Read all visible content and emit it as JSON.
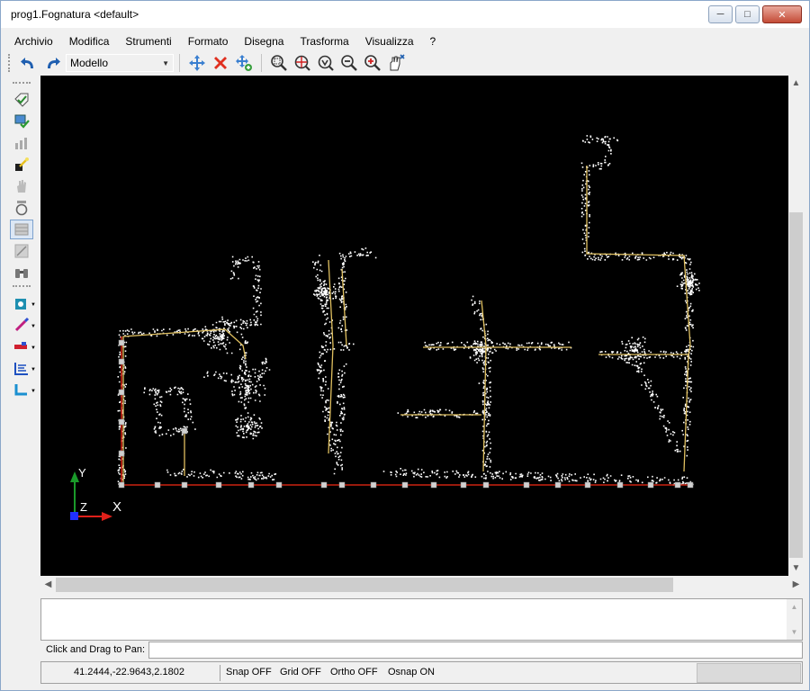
{
  "window": {
    "title": "prog1.Fognatura <default>",
    "controls": {
      "minimize": "─",
      "maximize": "□",
      "close": "✕"
    }
  },
  "menu": [
    "Archivio",
    "Modifica",
    "Strumenti",
    "Formato",
    "Disegna",
    "Trasforma",
    "Visualizza",
    "?"
  ],
  "toolbar": {
    "space_combo": "Modello",
    "buttons": [
      "undo-icon",
      "redo-icon",
      "move-icon",
      "delete-icon",
      "copy-move-icon",
      "zoom-window-icon",
      "zoom-center-icon",
      "zoom-extents-icon",
      "zoom-out-icon",
      "zoom-in-icon",
      "pan-icon"
    ]
  },
  "left_toolbar": [
    "properties-icon",
    "check-icon",
    "chart-icon",
    "wand-icon",
    "hand-icon",
    "manhole-icon",
    "grid-select-icon",
    "tile-icon",
    "binoculars-icon",
    "cam-icon",
    "brush-icon",
    "pipe-icon",
    "profile-icon",
    "connection-icon"
  ],
  "axes": {
    "y_label": "Y",
    "z_label": "Z",
    "x_label": "X"
  },
  "colors": {
    "canvas_bg": "#000000",
    "points": "#ffffff",
    "pipe_red": "#cc2211",
    "pipe_yellow": "#e0c060",
    "axis_green": "#1a9a2a",
    "axis_red": "#e0201a",
    "axis_blue": "#2030ff"
  },
  "command": {
    "history": "",
    "prompt_label": "Click and Drag to Pan:",
    "prompt_value": ""
  },
  "status": {
    "coordinates": "41.2444,-22.9643,2.1802",
    "snap": "Snap OFF",
    "grid": "Grid OFF",
    "ortho": "Ortho OFF",
    "osnap": "Osnap ON"
  }
}
